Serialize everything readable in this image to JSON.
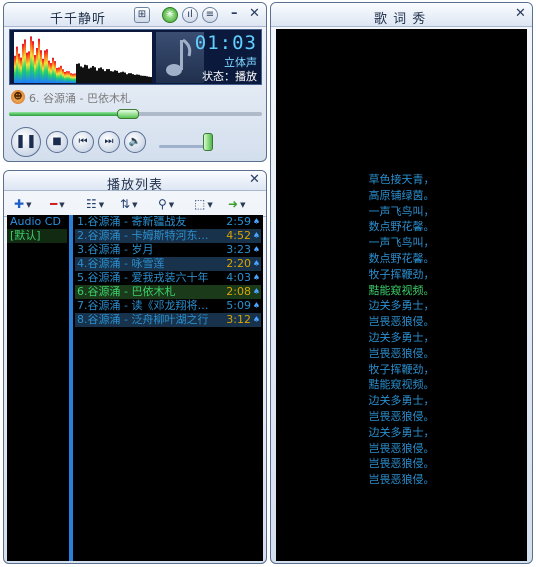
{
  "player": {
    "title": "千千静听",
    "time": "01:03",
    "mode": "立体声",
    "status": "状态：播放",
    "now_playing": "6. 谷源涌 - 巴依木札",
    "progress_fraction": 0.47,
    "volume_fraction": 0.82
  },
  "playlist": {
    "title": "播放列表",
    "groups": [
      {
        "label": "Audio CD",
        "color": "#2c8fe0"
      },
      {
        "label": "[默认]",
        "color": "#3cd06a"
      }
    ],
    "tracks": [
      {
        "title": "1.谷源涌 - 寄新疆战友",
        "duration": "2:59",
        "color": "#2b8fd0",
        "style": "normal"
      },
      {
        "title": "2.谷源涌 - 卡姆斯特河东…",
        "duration": "4:52",
        "color": "#2b8fd0",
        "style": "alt",
        "dur_color": "#d9a400"
      },
      {
        "title": "3.谷源涌 - 岁月",
        "duration": "3:23",
        "color": "#2b8fd0",
        "style": "normal"
      },
      {
        "title": "4.谷源涌 - 咏雪莲",
        "duration": "2:20",
        "color": "#2b8fd0",
        "style": "alt",
        "dur_color": "#d9a400"
      },
      {
        "title": "5.谷源涌 - 爱我戎装六十年",
        "duration": "4:03",
        "color": "#2b8fd0",
        "style": "normal"
      },
      {
        "title": "6.谷源涌 - 巴依木札",
        "duration": "2:08",
        "color": "#3cd06a",
        "style": "current",
        "dur_color": "#d9a400"
      },
      {
        "title": "7.谷源涌 - 读《邓龙翔将…",
        "duration": "5:09",
        "color": "#2b8fd0",
        "style": "normal"
      },
      {
        "title": "8.谷源涌 - 泛舟柳叶湖之行",
        "duration": "3:12",
        "color": "#2b8fd0",
        "style": "alt",
        "dur_color": "#d9a400"
      }
    ]
  },
  "lyrics": {
    "title": "歌 词 秀",
    "lines": [
      "草色接天青，",
      "高原铺绿茵。",
      "一声飞鸟叫，",
      "数点野花馨。",
      "一声飞鸟叫，",
      "数点野花馨。",
      "牧子挥鞭劲，",
      "黠能窥视频。",
      "边关多勇士，",
      "岂畏恶狼侵。",
      "边关多勇士，",
      "岂畏恶狼侵。",
      "牧子挥鞭劲，",
      "黠能窥视频。",
      "边关多勇士，",
      "岂畏恶狼侵。",
      "边关多勇士，",
      "岂畏恶狼侵。",
      "岂畏恶狼侵。",
      "岂畏恶狼侵。"
    ],
    "highlight_index": 7
  },
  "colors": {
    "lyric_text": "#2b8fd0",
    "lyric_highlight": "#3cd06a",
    "accent_blue": "#2c7fd8"
  }
}
